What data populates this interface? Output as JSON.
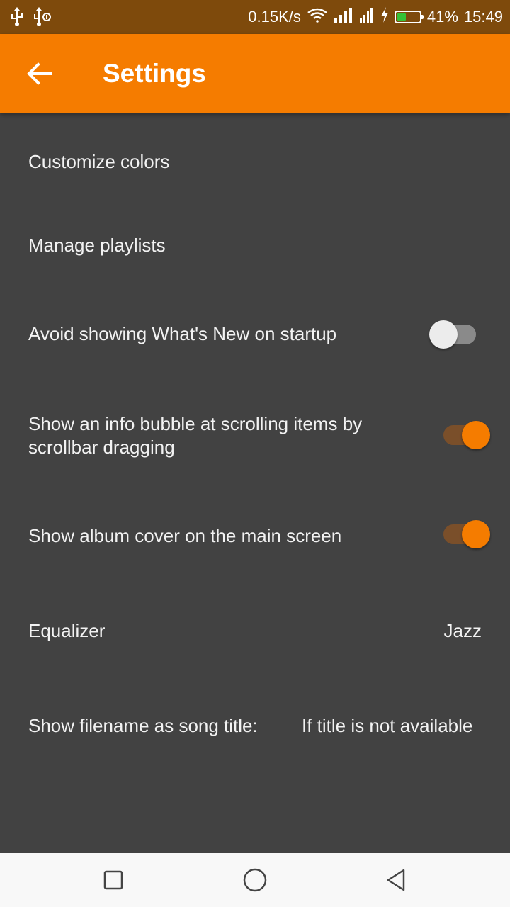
{
  "status_bar": {
    "network_speed": "0.15K/s",
    "battery_percent": "41%",
    "battery_level": 0.41,
    "time": "15:49",
    "icons": [
      "usb-icon",
      "usb-debug-icon",
      "wifi-icon",
      "signal-icon",
      "signal-icon-2",
      "charging-icon",
      "battery-icon"
    ]
  },
  "app_bar": {
    "title": "Settings",
    "back_icon": "arrow-back-icon"
  },
  "settings": {
    "customize_colors": {
      "label": "Customize colors"
    },
    "manage_playlists": {
      "label": "Manage playlists"
    },
    "avoid_whats_new": {
      "label": "Avoid showing What's New on startup",
      "enabled": false
    },
    "info_bubble": {
      "label": "Show an info bubble at scrolling items by scrollbar dragging",
      "enabled": true
    },
    "album_cover": {
      "label": "Show album cover on the main screen",
      "enabled": true
    },
    "equalizer": {
      "label": "Equalizer",
      "value": "Jazz"
    },
    "filename_title": {
      "label": "Show filename as song title:",
      "value": "If title is not available"
    }
  },
  "nav_bar": {
    "buttons": [
      "recents-square-icon",
      "home-circle-icon",
      "back-triangle-icon"
    ]
  },
  "colors": {
    "accent": "#f57c00",
    "status_bar": "#7e4a0c",
    "background": "#424242"
  }
}
